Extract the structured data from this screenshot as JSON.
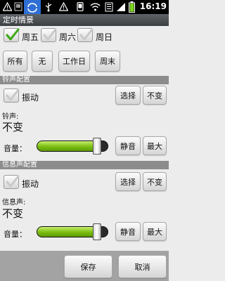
{
  "status_bar": {
    "time": "16:19",
    "icons": [
      "warning-icon",
      "image-icon",
      "sync-icon",
      "usb-icon",
      "alert-icon",
      "phone-icon",
      "wifi-icon",
      "bars-icon",
      "signal-icon",
      "battery-icon"
    ]
  },
  "title": "定时情景",
  "days": [
    {
      "label": "周五",
      "checked": true
    },
    {
      "label": "周六",
      "checked": false
    },
    {
      "label": "周日",
      "checked": false
    }
  ],
  "presets": [
    "所有",
    "无",
    "工作日",
    "周末"
  ],
  "ringtone": {
    "header": "铃声配置",
    "vibrate_label": "振动",
    "vibrate_checked": false,
    "select_label": "选择",
    "unchanged_label": "不变",
    "tone_label": "铃声:",
    "tone_value": "不变",
    "volume_label": "音量：",
    "volume_fraction": 0.85,
    "mute_label": "静音",
    "max_label": "最大"
  },
  "message": {
    "header": "信息声配置",
    "vibrate_label": "振动",
    "vibrate_checked": false,
    "select_label": "选择",
    "unchanged_label": "不变",
    "tone_label": "信息声:",
    "tone_value": "不变",
    "volume_label": "音量：",
    "volume_fraction": 0.85,
    "mute_label": "静音",
    "max_label": "最大"
  },
  "footer": {
    "save_label": "保存",
    "cancel_label": "取消"
  },
  "colors": {
    "accent_green": "#7bbd12",
    "check_green": "#3aa814",
    "title_bg": "#4a4d50",
    "section_bg": "#8c8c8c"
  }
}
